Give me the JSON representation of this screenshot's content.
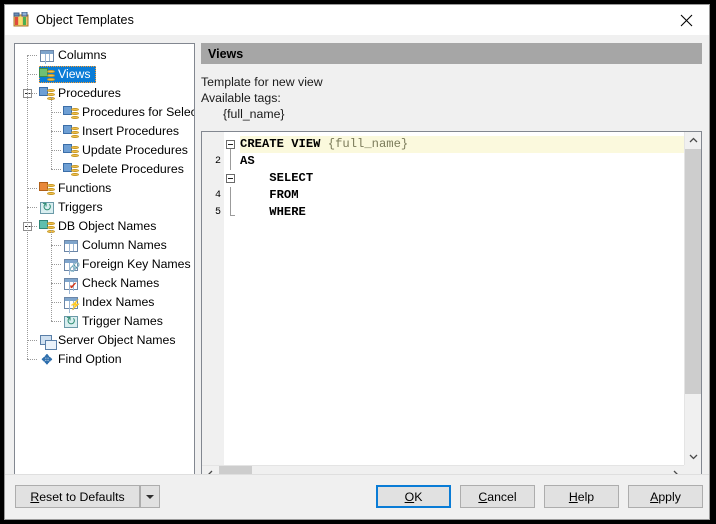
{
  "window": {
    "title": "Object Templates",
    "app_icon": "object-templates-icon",
    "close_icon": "close-icon"
  },
  "tree": {
    "items": [
      {
        "label": "Columns",
        "level": 1,
        "icon": "table-icon",
        "selected": false,
        "expander": null
      },
      {
        "label": "Views",
        "level": 1,
        "icon": "view-db-icon",
        "selected": true,
        "expander": null
      },
      {
        "label": "Procedures",
        "level": 1,
        "icon": "procedure-db-icon",
        "selected": false,
        "expander": "collapse"
      },
      {
        "label": "Procedures for Select",
        "level": 2,
        "icon": "procedure-db-icon",
        "selected": false,
        "expander": null
      },
      {
        "label": "Insert Procedures",
        "level": 2,
        "icon": "procedure-db-icon",
        "selected": false,
        "expander": null
      },
      {
        "label": "Update Procedures",
        "level": 2,
        "icon": "procedure-db-icon",
        "selected": false,
        "expander": null
      },
      {
        "label": "Delete Procedures",
        "level": 2,
        "icon": "procedure-db-icon",
        "selected": false,
        "expander": null
      },
      {
        "label": "Functions",
        "level": 1,
        "icon": "function-db-icon",
        "selected": false,
        "expander": null
      },
      {
        "label": "Triggers",
        "level": 1,
        "icon": "trigger-icon",
        "selected": false,
        "expander": null
      },
      {
        "label": "DB Object Names",
        "level": 1,
        "icon": "db-object-icon",
        "selected": false,
        "expander": "collapse"
      },
      {
        "label": "Column Names",
        "level": 2,
        "icon": "table-icon",
        "selected": false,
        "expander": null
      },
      {
        "label": "Foreign Key Names",
        "level": 2,
        "icon": "foreign-key-icon",
        "selected": false,
        "expander": null
      },
      {
        "label": "Check Names",
        "level": 2,
        "icon": "check-icon",
        "selected": false,
        "expander": null
      },
      {
        "label": "Index Names",
        "level": 2,
        "icon": "index-icon",
        "selected": false,
        "expander": null
      },
      {
        "label": "Trigger Names",
        "level": 2,
        "icon": "trigger-icon",
        "selected": false,
        "expander": null
      },
      {
        "label": "Server Object Names",
        "level": 1,
        "icon": "server-icon",
        "selected": false,
        "expander": null
      },
      {
        "label": "Find Option",
        "level": 1,
        "icon": "find-icon",
        "selected": false,
        "expander": null
      }
    ]
  },
  "details": {
    "header": "Views",
    "description_line1": "Template for new view",
    "description_line2": "Available tags:",
    "tag": "{full_name}"
  },
  "editor": {
    "lines": [
      {
        "number": "",
        "show_number": false,
        "fold": "box",
        "text_kw": "CREATE VIEW ",
        "text_tag": "{full_name}",
        "indent": 0,
        "highlight": true
      },
      {
        "number": "2",
        "show_number": true,
        "fold": "tick",
        "text_kw": "AS",
        "text_tag": "",
        "indent": 0,
        "highlight": false
      },
      {
        "number": "",
        "show_number": false,
        "fold": "box",
        "text_kw": "SELECT",
        "text_tag": "",
        "indent": 2,
        "highlight": false
      },
      {
        "number": "4",
        "show_number": true,
        "fold": "line",
        "text_kw": "FROM",
        "text_tag": "",
        "indent": 2,
        "highlight": false
      },
      {
        "number": "5",
        "show_number": true,
        "fold": "end",
        "text_kw": "WHERE",
        "text_tag": "",
        "indent": 2,
        "highlight": false
      }
    ],
    "vscroll_icon_up": "chevron-up-icon",
    "vscroll_icon_down": "chevron-down-icon",
    "hscroll_icon_left": "chevron-left-icon",
    "hscroll_icon_right": "chevron-right-icon"
  },
  "footer": {
    "reset": {
      "pre": "",
      "mnemonic": "R",
      "post": "eset to Defaults"
    },
    "reset_arrow_icon": "chevron-down-icon",
    "ok": {
      "pre": "",
      "mnemonic": "O",
      "post": "K"
    },
    "cancel": {
      "pre": "",
      "mnemonic": "C",
      "post": "ancel"
    },
    "help": {
      "pre": "",
      "mnemonic": "H",
      "post": "elp"
    },
    "apply": {
      "pre": "",
      "mnemonic": "A",
      "post": "pply"
    }
  },
  "colors": {
    "selection": "#0a7cd6",
    "section_header_bg": "#a6a6a6",
    "highlight_line": "#fbf9dd",
    "tag_text": "#7b7b5a",
    "default_button_border": "#0a7cd6"
  }
}
